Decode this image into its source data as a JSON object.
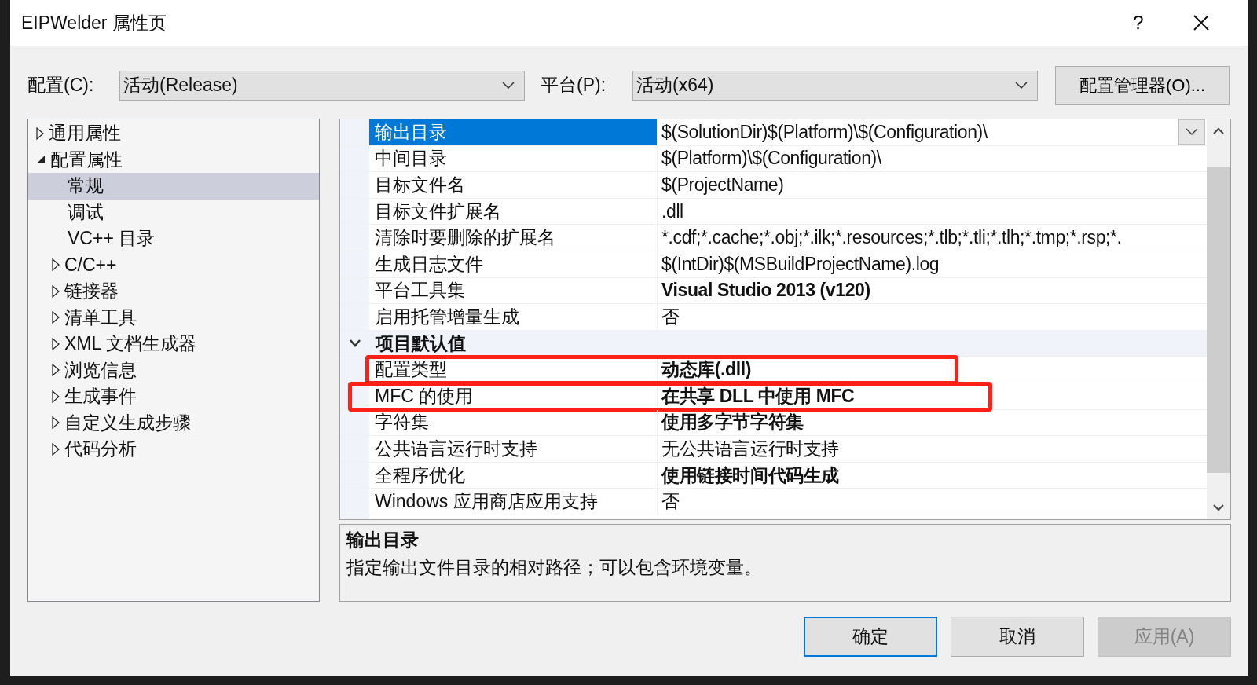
{
  "window": {
    "title": "EIPWelder 属性页",
    "help": "?"
  },
  "configuration": {
    "label": "配置(C):",
    "value": "活动(Release)"
  },
  "platform": {
    "label": "平台(P):",
    "value": "活动(x64)"
  },
  "config_manager_button": "配置管理器(O)...",
  "tree": [
    {
      "label": "通用属性",
      "kind": "node",
      "expanded": false,
      "selected": false
    },
    {
      "label": "配置属性",
      "kind": "node",
      "expanded": true,
      "selected": false,
      "children": [
        {
          "label": "常规",
          "kind": "leaf",
          "selected": true
        },
        {
          "label": "调试",
          "kind": "leaf",
          "selected": false
        },
        {
          "label": "VC++ 目录",
          "kind": "leaf",
          "selected": false
        },
        {
          "label": "C/C++",
          "kind": "node",
          "expanded": false,
          "selected": false
        },
        {
          "label": "链接器",
          "kind": "node",
          "expanded": false,
          "selected": false
        },
        {
          "label": "清单工具",
          "kind": "node",
          "expanded": false,
          "selected": false
        },
        {
          "label": "XML 文档生成器",
          "kind": "node",
          "expanded": false,
          "selected": false
        },
        {
          "label": "浏览信息",
          "kind": "node",
          "expanded": false,
          "selected": false
        },
        {
          "label": "生成事件",
          "kind": "node",
          "expanded": false,
          "selected": false
        },
        {
          "label": "自定义生成步骤",
          "kind": "node",
          "expanded": false,
          "selected": false
        },
        {
          "label": "代码分析",
          "kind": "node",
          "expanded": false,
          "selected": false
        }
      ]
    }
  ],
  "properties": [
    {
      "kind": "property",
      "name": "输出目录",
      "value": "$(SolutionDir)$(Platform)\\$(Configuration)\\",
      "bold": false,
      "selected": true
    },
    {
      "kind": "property",
      "name": "中间目录",
      "value": "$(Platform)\\$(Configuration)\\",
      "bold": false,
      "selected": false
    },
    {
      "kind": "property",
      "name": "目标文件名",
      "value": "$(ProjectName)",
      "bold": false,
      "selected": false
    },
    {
      "kind": "property",
      "name": "目标文件扩展名",
      "value": ".dll",
      "bold": false,
      "selected": false
    },
    {
      "kind": "property",
      "name": "清除时要删除的扩展名",
      "value": "*.cdf;*.cache;*.obj;*.ilk;*.resources;*.tlb;*.tli;*.tlh;*.tmp;*.rsp;*.",
      "bold": false,
      "selected": false
    },
    {
      "kind": "property",
      "name": "生成日志文件",
      "value": "$(IntDir)$(MSBuildProjectName).log",
      "bold": false,
      "selected": false
    },
    {
      "kind": "property",
      "name": "平台工具集",
      "value": "Visual Studio 2013 (v120)",
      "bold": true,
      "selected": false
    },
    {
      "kind": "property",
      "name": "启用托管增量生成",
      "value": "否",
      "bold": false,
      "selected": false
    },
    {
      "kind": "category",
      "name": "项目默认值",
      "expanded": true
    },
    {
      "kind": "property",
      "name": "配置类型",
      "value": "动态库(.dll)",
      "bold": true,
      "selected": false,
      "highlighted": true
    },
    {
      "kind": "property",
      "name": "MFC 的使用",
      "value": "在共享 DLL 中使用 MFC",
      "bold": true,
      "selected": false,
      "highlighted": true
    },
    {
      "kind": "property",
      "name": "字符集",
      "value": "使用多字节字符集",
      "bold": true,
      "selected": false
    },
    {
      "kind": "property",
      "name": "公共语言运行时支持",
      "value": "无公共语言运行时支持",
      "bold": false,
      "selected": false
    },
    {
      "kind": "property",
      "name": "全程序优化",
      "value": "使用链接时间代码生成",
      "bold": true,
      "selected": false
    },
    {
      "kind": "property",
      "name": "Windows 应用商店应用支持",
      "value": "否",
      "bold": false,
      "selected": false
    }
  ],
  "description": {
    "title": "输出目录",
    "text": "指定输出文件目录的相对路径；可以包含环境变量。"
  },
  "buttons": [
    {
      "label": "确定",
      "default": true,
      "disabled": false
    },
    {
      "label": "取消",
      "default": false,
      "disabled": false
    },
    {
      "label": "应用(A)",
      "default": false,
      "disabled": true
    }
  ]
}
